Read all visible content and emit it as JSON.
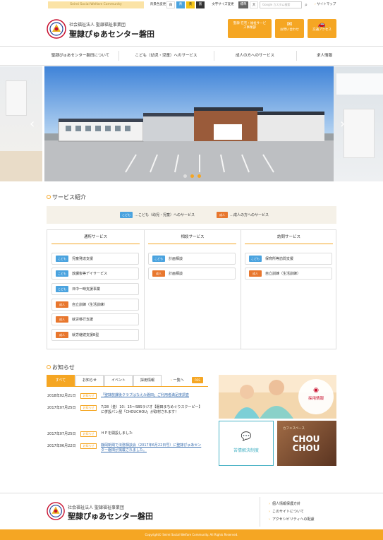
{
  "topbar": {
    "community": "Seirei Social Welfare Community",
    "color_label": "背景色変更",
    "color_options": [
      "白",
      "青",
      "黄",
      "黒"
    ],
    "size_label": "文字サイズ変更",
    "size_options": [
      "標準",
      "大"
    ],
    "search_placeholder": "Google カスタム検索",
    "sitemap": "サイトマップ"
  },
  "header": {
    "org_line1": "社会福祉法人 聖隷福祉事業団",
    "org_name": "聖隷ぴゅあセンター磐田",
    "btn_services": "聖隷 在宅・福祉サービス事業部",
    "btn_contact": "お問い合わせ",
    "btn_access": "交通アクセス"
  },
  "nav": [
    "聖隷ぴゅあセンター磐田について",
    "こども（幼児・児童）へのサービス",
    "成人の方へのサービス",
    "求人情報"
  ],
  "slider": {
    "active_index": 0,
    "count": 3
  },
  "services": {
    "title": "サービス紹介",
    "legend_child_tag": "こども",
    "legend_child": "…こども（幼児・児童）へのサービス",
    "legend_adult_tag": "成人",
    "legend_adult": "…成人の方へのサービス",
    "columns": [
      {
        "heading": "通所サービス",
        "items": [
          {
            "tag": "こども",
            "kind": "child",
            "name": "児童発達支援"
          },
          {
            "tag": "こども",
            "kind": "child",
            "name": "放課後等デイサービス"
          },
          {
            "tag": "こども",
            "kind": "child",
            "name": "日中一時支援事業"
          },
          {
            "tag": "成人",
            "kind": "adult",
            "name": "自立訓練（生活訓練）"
          },
          {
            "tag": "成人",
            "kind": "adult",
            "name": "就労移行支援"
          },
          {
            "tag": "成人",
            "kind": "adult",
            "name": "就労継続支援B型"
          }
        ]
      },
      {
        "heading": "相談サービス",
        "items": [
          {
            "tag": "こども",
            "kind": "child",
            "name": "計画相談"
          },
          {
            "tag": "成人",
            "kind": "adult",
            "name": "計画相談"
          }
        ]
      },
      {
        "heading": "訪問サービス",
        "items": [
          {
            "tag": "こども",
            "kind": "child",
            "name": "保育所等訪問支援"
          },
          {
            "tag": "成人",
            "kind": "adult",
            "name": "自立訓練（生活訓練）"
          }
        ]
      }
    ]
  },
  "news": {
    "title": "お知らせ",
    "tabs": [
      "すべて",
      "お知らせ",
      "イベント",
      "採用情報"
    ],
    "list_link": "一覧へ",
    "rss": "RSS",
    "items": [
      {
        "date": "2018年02月21日",
        "tag": "お知らせ",
        "title": "「聖隷放課後クラブはなえみ磐田」ご利用者満足度調査",
        "link": true
      },
      {
        "date": "2017年07月25日",
        "tag": "お知らせ",
        "title": "7/28（金）10：15〜SBSラジオ【磐田まちめぐりスクーピー】に併設パン屋「CHOUCHOU」が取材されます！",
        "link": false
      },
      {
        "date": "2017年07月25日",
        "tag": "お知らせ",
        "title": "ＨＰを開設しました",
        "link": false
      },
      {
        "date": "2017年06月22日",
        "tag": "お知らせ",
        "title": "静岡新聞で法務相談会（2017年6月22日号）に聖隷ぴゅあセンター磐田が掲載されました。",
        "link": true
      }
    ]
  },
  "banners": {
    "recruit": "採用情報",
    "complaint": "苦情解決制度",
    "chou_sub": "カフェスペース",
    "chou": "CHOU CHOU"
  },
  "footer": {
    "org_line1": "社会福祉法人 聖隷福祉事業団",
    "org_name": "聖隷ぴゅあセンター磐田",
    "links": [
      "個人情報保護方針",
      "このサイトについて",
      "アクセシビリティへの配慮"
    ],
    "copyright": "Copyright© Seirei Social Welfare Community. All Rights Reserved."
  },
  "colors": {
    "accent": "#f5a623",
    "child": "#4aa3df",
    "adult": "#e8772e"
  }
}
